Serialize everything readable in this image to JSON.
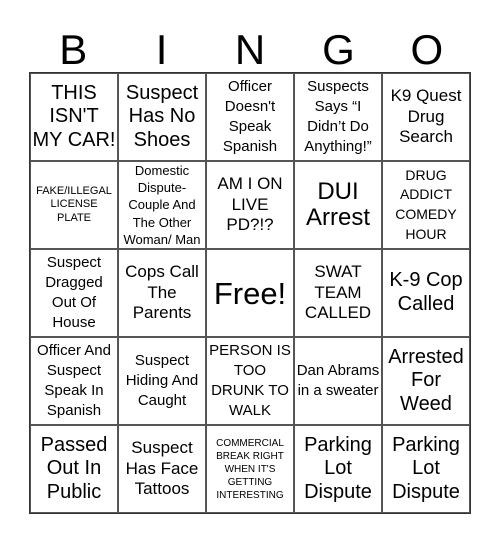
{
  "header": {
    "letters": [
      "B",
      "I",
      "N",
      "G",
      "O"
    ]
  },
  "card": {
    "cells": [
      [
        "THIS ISN'T MY CAR!",
        "Suspect Has No Shoes",
        "Officer Doesn't Speak Spanish",
        "Suspects Says “I Didn’t Do Anything!”",
        "K9 Quest Drug Search"
      ],
      [
        "FAKE/ILLEGAL LICENSE PLATE",
        "Domestic Dispute- Couple And The Other Woman/ Man",
        "AM I ON LIVE PD?!?",
        "DUI Arrest",
        "DRUG ADDICT COMEDY HOUR"
      ],
      [
        "Suspect Dragged Out Of House",
        "Cops Call The Parents",
        "Free!",
        "SWAT TEAM CALLED",
        "K-9 Cop Called"
      ],
      [
        "Officer And Suspect Speak In Spanish",
        "Suspect Hiding And Caught",
        "PERSON IS TOO DRUNK TO WALK",
        "Dan Abrams in a sweater",
        "Arrested For Weed"
      ],
      [
        "Passed Out In Public",
        "Suspect Has Face Tattoos",
        "COMMERCIAL BREAK RIGHT WHEN IT'S GETTING INTERESTING",
        "Parking Lot Dispute",
        "Parking Lot Dispute"
      ]
    ]
  }
}
